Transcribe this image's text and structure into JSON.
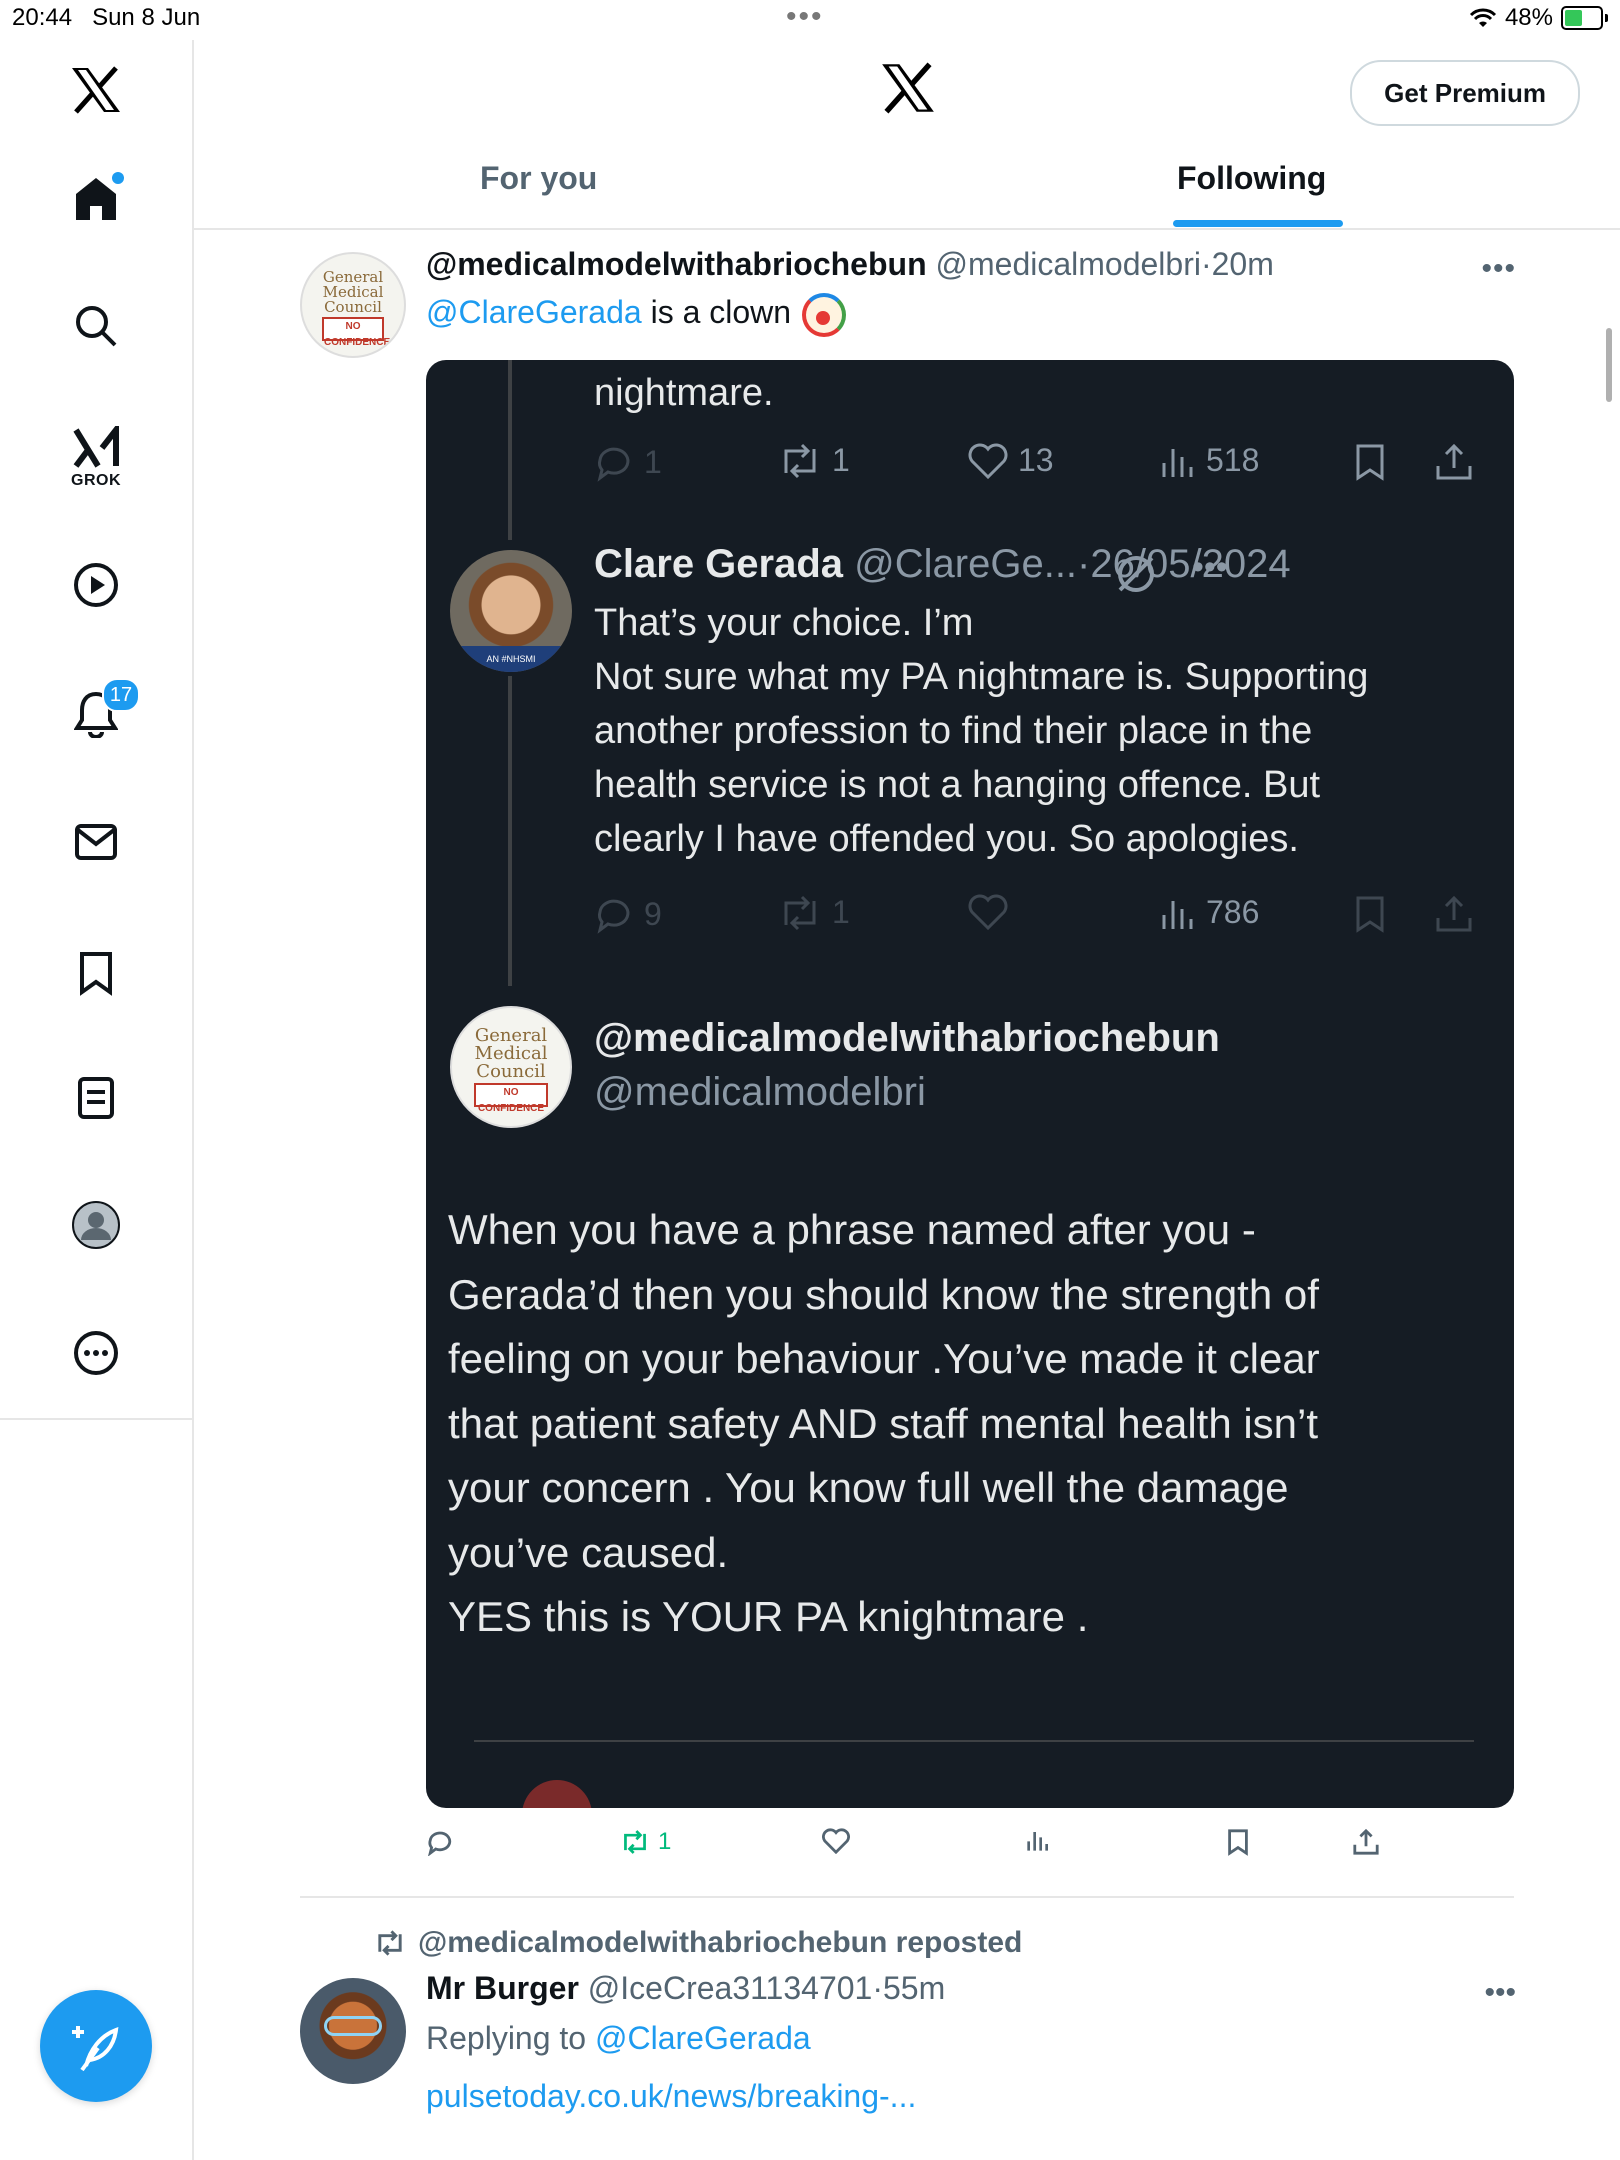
{
  "status_bar": {
    "time": "20:44",
    "date": "Sun 8 Jun",
    "dots": "•••",
    "battery": "48%"
  },
  "nav": {
    "notifications_badge": "17",
    "grok_label": "GROK"
  },
  "header": {
    "premium_button": "Get Premium",
    "tabs": [
      "For you",
      "Following"
    ],
    "active_tab": "Following"
  },
  "tweet": {
    "display_name": "@medicalmodelwithabriochebun",
    "handle": "@medicalmodelbri",
    "sep": "·",
    "time": "20m",
    "mention": "@ClareGerada",
    "text": " is a clown",
    "more": "•••",
    "embed": {
      "top_text": "nightmare.",
      "top_actions": {
        "replies": "1",
        "reposts": "1",
        "likes": "13",
        "views": "518"
      },
      "reply": {
        "name": "Clare Gerada",
        "handle": "@ClareGe...",
        "date": "26/05/2024",
        "sep": "·",
        "lines": [
          "That’s your choice. I’m",
          "Not sure what my PA nightmare is. Supporting",
          "another profession to find their place in the",
          "health service is not a hanging offence. But",
          "clearly I have offended you. So apologies."
        ],
        "actions": {
          "replies": "9",
          "reposts": "1",
          "views": "786"
        },
        "avatar_caption": "AN #NHSMI"
      },
      "author": {
        "name": "@medicalmodelwithabriochebun",
        "handle": "@medicalmodelbri"
      },
      "body_lines": [
        "When you have a phrase named after you -",
        "Gerada’d then you should know the strength of",
        "feeling on your behaviour .You’ve made it clear",
        "that patient safety AND staff mental health isn’t",
        "your concern . You know full well the damage",
        "you’ve caused."
      ],
      "closing": "YES this is YOUR PA knightmare ."
    },
    "actions": {
      "reposts": "1"
    }
  },
  "avatar_art": {
    "gmc_lines": [
      "General",
      "Medical",
      "Council"
    ],
    "gmc_stamp": "NO CONFIDENCE"
  },
  "tweet2": {
    "repost_label": "@medicalmodelwithabriochebun reposted",
    "display_name": "Mr Burger",
    "handle": "@IceCrea31134701",
    "sep": "·",
    "time": "55m",
    "replying_prefix": "Replying to ",
    "replying_to": "@ClareGerada",
    "link": "pulsetoday.co.uk/news/breaking-...",
    "more": "•••"
  },
  "colors": {
    "accent": "#1d9bf0",
    "repost_green": "#00ba7c",
    "embed_bg": "#151c24"
  }
}
